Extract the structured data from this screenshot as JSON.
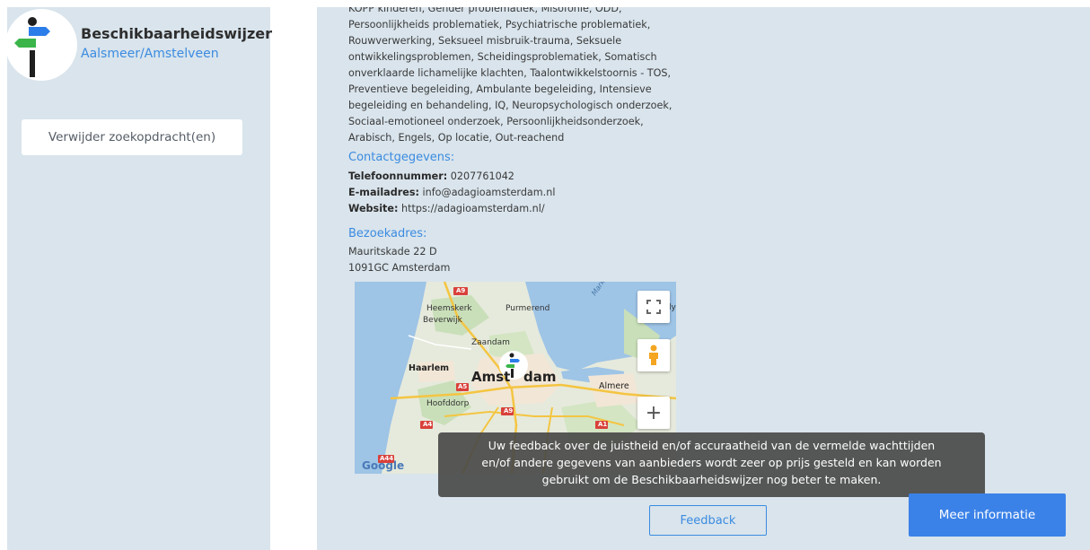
{
  "brand": {
    "title": "Beschikbaarheidswijzer",
    "subtitle": "Aalsmeer/Amstelveen"
  },
  "sidebar": {
    "clear_button": "Verwijder zoekopdracht(en)"
  },
  "provider": {
    "description_lines": [
      "KOPP kinderen, Gender problematiek, Misofonie, ODD,",
      "Persoonlijkheids problematiek, Psychiatrische problematiek,",
      "Rouwverwerking, Seksueel misbruik-trauma, Seksuele",
      "ontwikkelingsproblemen, Scheidingsproblematiek, Somatisch",
      "onverklaarde lichamelijke klachten, Taalontwikkelstoornis - TOS,",
      "Preventieve begeleiding, Ambulante begeleiding, Intensieve",
      "begeleiding en behandeling, IQ, Neuropsychologisch onderzoek,",
      "Sociaal-emotioneel onderzoek, Persoonlijkheidsonderzoek,",
      "Arabisch, Engels, Op locatie, Out-reachend"
    ],
    "contact": {
      "heading": "Contactgegevens:",
      "phone_label": "Telefoonnummer:",
      "phone": "0207761042",
      "email_label": "E-mailadres:",
      "email": "info@adagioamsterdam.nl",
      "website_label": "Website:",
      "website": "https://adagioamsterdam.nl/"
    },
    "address": {
      "heading": "Bezoekadres:",
      "street": "Mauritskade 22 D",
      "postal_city": "1091GC Amsterdam"
    }
  },
  "map": {
    "labels": {
      "heemskerk": "Heemskerk",
      "beverwijk": "Beverwijk",
      "purmerend": "Purmerend",
      "zaandam": "Zaandam",
      "haarlem": "Haarlem",
      "amsterdam": "Amst",
      "amsterdam_end": "dam",
      "almere": "Almere",
      "hoofddorp": "Hoofddorp",
      "markermeer": "Markermeer",
      "lelystad_fragment": "ly",
      "a9": "A9",
      "a5": "A5",
      "a4": "A4",
      "a1": "A1",
      "a44": "A44",
      "google": "Google"
    },
    "controls": {
      "fullscreen_icon": "fullscreen-icon",
      "pegman_icon": "pegman-icon",
      "zoom_in": "+"
    }
  },
  "tooltip": {
    "lines": [
      "Uw feedback over de juistheid en/of accuraatheid van de vermelde wachttijden",
      "en/of andere gegevens van aanbieders wordt zeer op prijs gesteld en kan worden",
      "gebruikt om de Beschikbaarheidswijzer nog beter te maken."
    ]
  },
  "actions": {
    "feedback": "Feedback",
    "more_info": "Meer informatie"
  },
  "colors": {
    "panel_bg": "#d9e4ec",
    "accent": "#3b8be0",
    "primary_button": "#3b82e8"
  }
}
